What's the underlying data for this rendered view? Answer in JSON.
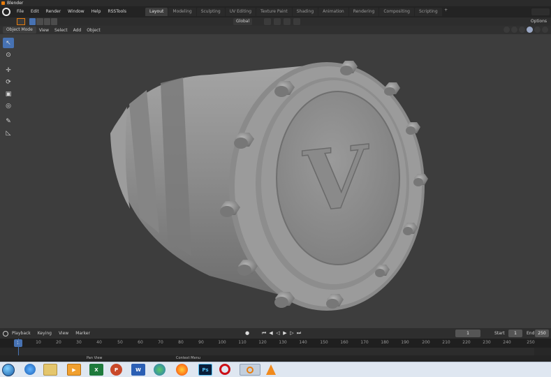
{
  "window": {
    "title": "Blender"
  },
  "menubar": {
    "items": [
      "File",
      "Edit",
      "Render",
      "Window",
      "Help",
      "RSSTools"
    ],
    "workspaces": [
      "Layout",
      "Modeling",
      "Sculpting",
      "UV Editing",
      "Texture Paint",
      "Shading",
      "Animation",
      "Rendering",
      "Compositing",
      "Scripting"
    ],
    "active_workspace": "Layout",
    "add_label": "+"
  },
  "tool_header": {
    "orientation": "Global",
    "options_label": "Options"
  },
  "viewport_header": {
    "mode": "Object Mode",
    "menus": [
      "View",
      "Select",
      "Add",
      "Object"
    ]
  },
  "viewport": {
    "emblem_letter": "V",
    "model_color": "#8f8f8f",
    "background_color": "#3d3d3d",
    "tools": [
      "select-box-icon",
      "cursor-icon",
      "move-icon",
      "rotate-icon",
      "scale-icon",
      "transform-icon",
      "annotate-icon",
      "measure-icon"
    ]
  },
  "timeline": {
    "menus": [
      "Playback",
      "Keying",
      "View",
      "Marker"
    ],
    "current_frame": "1",
    "start_label": "Start",
    "start": "1",
    "end_label": "End",
    "end": "250",
    "ruler_ticks": [
      "1",
      "10",
      "20",
      "30",
      "40",
      "50",
      "60",
      "70",
      "80",
      "90",
      "100",
      "110",
      "120",
      "130",
      "140",
      "150",
      "160",
      "170",
      "180",
      "190",
      "200",
      "210",
      "220",
      "230",
      "240",
      "250"
    ],
    "playhead_label": "1"
  },
  "statusbar": {
    "left": "Pan View",
    "right": "Context Menu"
  },
  "taskbar": {
    "apps": [
      "internet-explorer",
      "file-explorer",
      "media-player",
      "excel",
      "powerpoint",
      "word",
      "network",
      "firefox",
      "photoshop",
      "opera",
      "blender",
      "vlc"
    ],
    "ps_label": "Ps",
    "xl_label": "X",
    "wd_label": "W",
    "pp_label": "P"
  },
  "colors": {
    "accent": "#4772b3",
    "highlight": "#e87d0d",
    "opera_red": "#cc0f16",
    "firefox_orange": "#ff7a1a"
  }
}
